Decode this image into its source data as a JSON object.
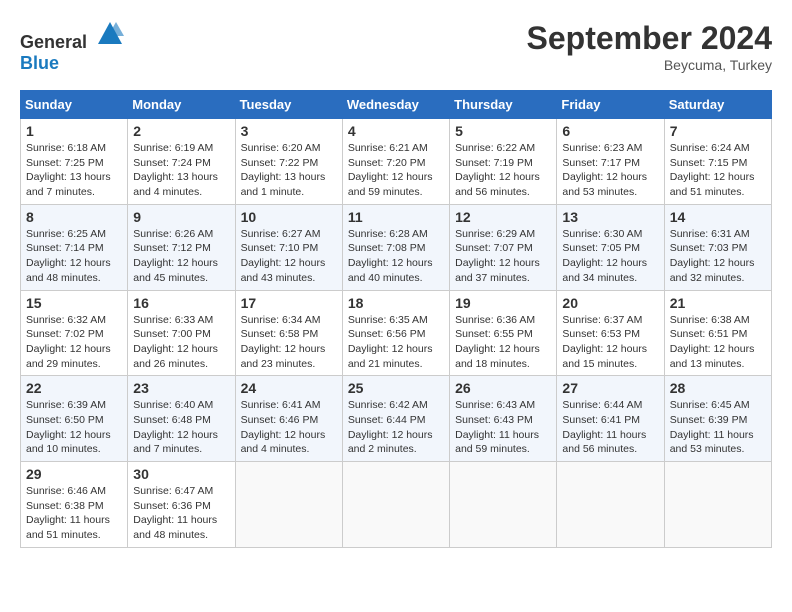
{
  "header": {
    "logo_general": "General",
    "logo_blue": "Blue",
    "month_title": "September 2024",
    "location": "Beycuma, Turkey"
  },
  "days_of_week": [
    "Sunday",
    "Monday",
    "Tuesday",
    "Wednesday",
    "Thursday",
    "Friday",
    "Saturday"
  ],
  "weeks": [
    [
      {
        "day": "1",
        "info": "Sunrise: 6:18 AM\nSunset: 7:25 PM\nDaylight: 13 hours and 7 minutes."
      },
      {
        "day": "2",
        "info": "Sunrise: 6:19 AM\nSunset: 7:24 PM\nDaylight: 13 hours and 4 minutes."
      },
      {
        "day": "3",
        "info": "Sunrise: 6:20 AM\nSunset: 7:22 PM\nDaylight: 13 hours and 1 minute."
      },
      {
        "day": "4",
        "info": "Sunrise: 6:21 AM\nSunset: 7:20 PM\nDaylight: 12 hours and 59 minutes."
      },
      {
        "day": "5",
        "info": "Sunrise: 6:22 AM\nSunset: 7:19 PM\nDaylight: 12 hours and 56 minutes."
      },
      {
        "day": "6",
        "info": "Sunrise: 6:23 AM\nSunset: 7:17 PM\nDaylight: 12 hours and 53 minutes."
      },
      {
        "day": "7",
        "info": "Sunrise: 6:24 AM\nSunset: 7:15 PM\nDaylight: 12 hours and 51 minutes."
      }
    ],
    [
      {
        "day": "8",
        "info": "Sunrise: 6:25 AM\nSunset: 7:14 PM\nDaylight: 12 hours and 48 minutes."
      },
      {
        "day": "9",
        "info": "Sunrise: 6:26 AM\nSunset: 7:12 PM\nDaylight: 12 hours and 45 minutes."
      },
      {
        "day": "10",
        "info": "Sunrise: 6:27 AM\nSunset: 7:10 PM\nDaylight: 12 hours and 43 minutes."
      },
      {
        "day": "11",
        "info": "Sunrise: 6:28 AM\nSunset: 7:08 PM\nDaylight: 12 hours and 40 minutes."
      },
      {
        "day": "12",
        "info": "Sunrise: 6:29 AM\nSunset: 7:07 PM\nDaylight: 12 hours and 37 minutes."
      },
      {
        "day": "13",
        "info": "Sunrise: 6:30 AM\nSunset: 7:05 PM\nDaylight: 12 hours and 34 minutes."
      },
      {
        "day": "14",
        "info": "Sunrise: 6:31 AM\nSunset: 7:03 PM\nDaylight: 12 hours and 32 minutes."
      }
    ],
    [
      {
        "day": "15",
        "info": "Sunrise: 6:32 AM\nSunset: 7:02 PM\nDaylight: 12 hours and 29 minutes."
      },
      {
        "day": "16",
        "info": "Sunrise: 6:33 AM\nSunset: 7:00 PM\nDaylight: 12 hours and 26 minutes."
      },
      {
        "day": "17",
        "info": "Sunrise: 6:34 AM\nSunset: 6:58 PM\nDaylight: 12 hours and 23 minutes."
      },
      {
        "day": "18",
        "info": "Sunrise: 6:35 AM\nSunset: 6:56 PM\nDaylight: 12 hours and 21 minutes."
      },
      {
        "day": "19",
        "info": "Sunrise: 6:36 AM\nSunset: 6:55 PM\nDaylight: 12 hours and 18 minutes."
      },
      {
        "day": "20",
        "info": "Sunrise: 6:37 AM\nSunset: 6:53 PM\nDaylight: 12 hours and 15 minutes."
      },
      {
        "day": "21",
        "info": "Sunrise: 6:38 AM\nSunset: 6:51 PM\nDaylight: 12 hours and 13 minutes."
      }
    ],
    [
      {
        "day": "22",
        "info": "Sunrise: 6:39 AM\nSunset: 6:50 PM\nDaylight: 12 hours and 10 minutes."
      },
      {
        "day": "23",
        "info": "Sunrise: 6:40 AM\nSunset: 6:48 PM\nDaylight: 12 hours and 7 minutes."
      },
      {
        "day": "24",
        "info": "Sunrise: 6:41 AM\nSunset: 6:46 PM\nDaylight: 12 hours and 4 minutes."
      },
      {
        "day": "25",
        "info": "Sunrise: 6:42 AM\nSunset: 6:44 PM\nDaylight: 12 hours and 2 minutes."
      },
      {
        "day": "26",
        "info": "Sunrise: 6:43 AM\nSunset: 6:43 PM\nDaylight: 11 hours and 59 minutes."
      },
      {
        "day": "27",
        "info": "Sunrise: 6:44 AM\nSunset: 6:41 PM\nDaylight: 11 hours and 56 minutes."
      },
      {
        "day": "28",
        "info": "Sunrise: 6:45 AM\nSunset: 6:39 PM\nDaylight: 11 hours and 53 minutes."
      }
    ],
    [
      {
        "day": "29",
        "info": "Sunrise: 6:46 AM\nSunset: 6:38 PM\nDaylight: 11 hours and 51 minutes."
      },
      {
        "day": "30",
        "info": "Sunrise: 6:47 AM\nSunset: 6:36 PM\nDaylight: 11 hours and 48 minutes."
      },
      null,
      null,
      null,
      null,
      null
    ]
  ]
}
